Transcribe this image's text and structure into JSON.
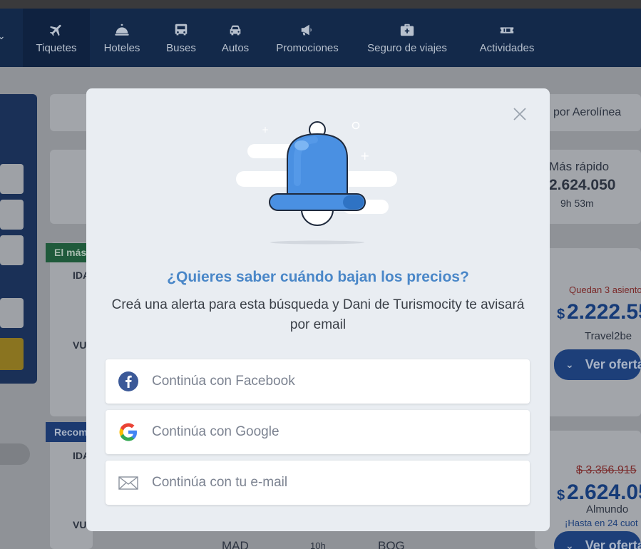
{
  "nav": {
    "items": [
      {
        "label": "Tiquetes",
        "icon": "airplane-icon"
      },
      {
        "label": "Hoteles",
        "icon": "hotel-bell-icon"
      },
      {
        "label": "Buses",
        "icon": "bus-icon"
      },
      {
        "label": "Autos",
        "icon": "car-icon"
      },
      {
        "label": "Promociones",
        "icon": "megaphone-icon"
      },
      {
        "label": "Seguro de viajes",
        "icon": "medkit-icon"
      },
      {
        "label": "Actividades",
        "icon": "ticket-icon"
      }
    ]
  },
  "background": {
    "sort_airline": "por Aerolínea",
    "fastest_label": "Más rápido",
    "fastest_price": "2.624.050",
    "fastest_duration": "9h 53m",
    "tag_best": "El más",
    "tag_recommended": "Recom",
    "ida1": "IDA",
    "vuelta1": "VU",
    "ida2": "IDA",
    "vuelta2": "VU",
    "seats_left": "Quedan 3 asiento",
    "price1_symbol": "$",
    "price1": "2.222.55",
    "agency1": "Travel2be",
    "offer_btn1": "Ver oferta",
    "old_price2": "$ 3.356.915",
    "price2_symbol": "$",
    "price2": "2.624.05",
    "agency2": "Almundo",
    "installments": "¡Hasta en 24 cuot",
    "offer_btn2": "Ver oferta",
    "origin": "MAD",
    "duration": "10h",
    "destination": "BOG"
  },
  "modal": {
    "title": "¿Quieres saber cuándo bajan los precios?",
    "subtitle": "Creá una alerta para esta búsqueda y Dani de Turismocity te avisará por email",
    "buttons": {
      "facebook": "Continúa con Facebook",
      "google": "Continúa con Google",
      "email": "Continúa con tu e-mail"
    }
  },
  "colors": {
    "nav_bg": "#13294a",
    "title_blue": "#4a87c8",
    "bell_blue": "#4a90e2",
    "facebook_blue": "#3b5998"
  }
}
